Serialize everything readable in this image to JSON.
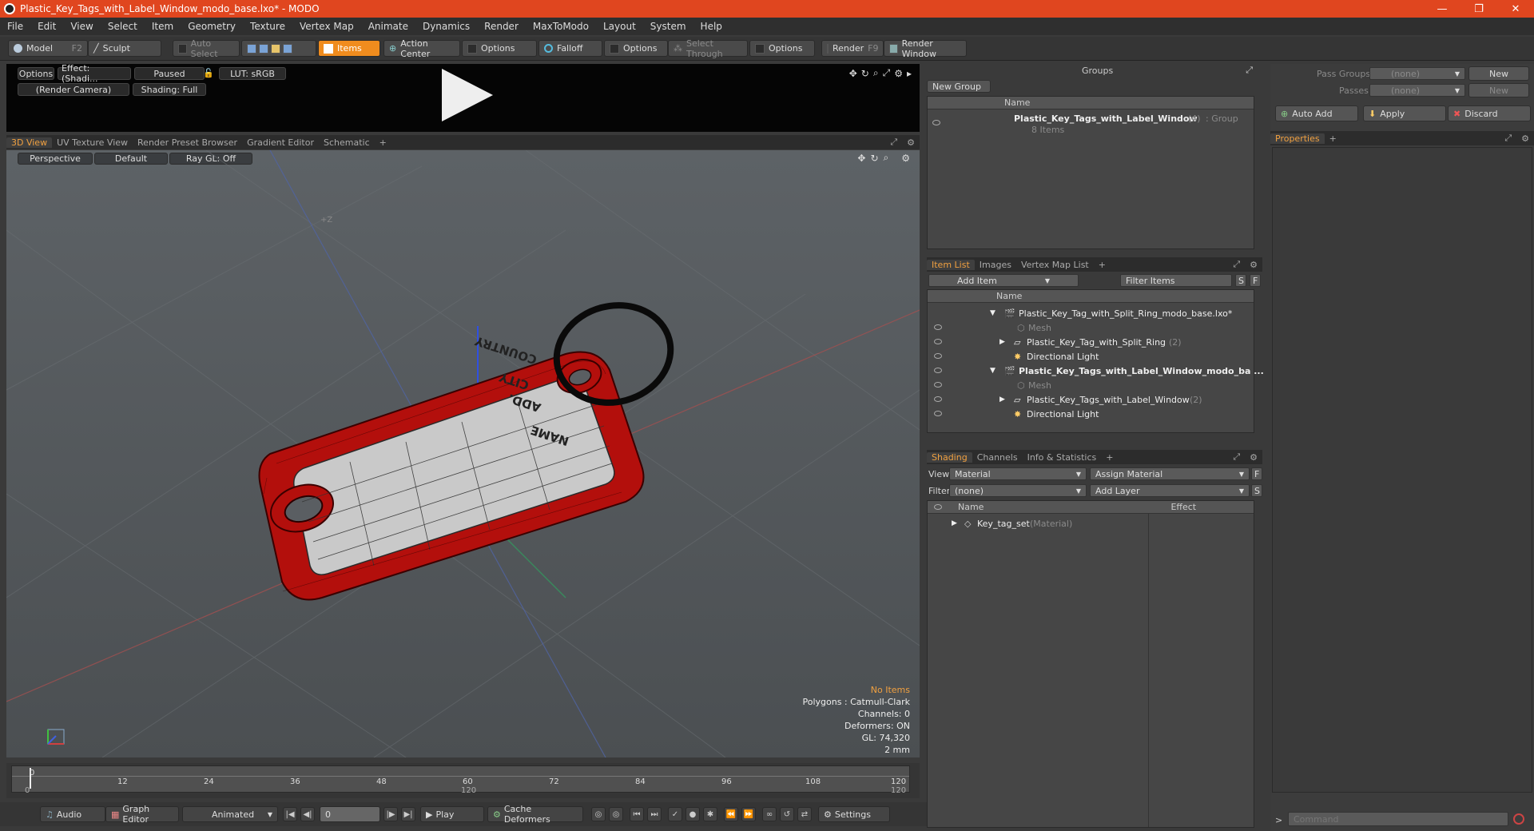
{
  "window": {
    "title": "Plastic_Key_Tags_with_Label_Window_modo_base.lxo* - MODO",
    "controls": [
      "—",
      "❐",
      "✕"
    ]
  },
  "menu": [
    "File",
    "Edit",
    "View",
    "Select",
    "Item",
    "Geometry",
    "Texture",
    "Vertex Map",
    "Animate",
    "Dynamics",
    "Render",
    "MaxToModo",
    "Layout",
    "System",
    "Help"
  ],
  "toolbar": {
    "model": "Model",
    "model_key": "F2",
    "sculpt": "Sculpt",
    "auto_select": "Auto Select",
    "items": "Items",
    "action_center": "Action Center",
    "options1": "Options",
    "falloff": "Falloff",
    "options2": "Options",
    "select_through": "Select Through",
    "options3": "Options",
    "render": "Render",
    "render_key": "F9",
    "render_window": "Render Window"
  },
  "preview": {
    "options": "Options",
    "effect": "Effect: (Shadi...",
    "paused": "Paused",
    "lut": "LUT: sRGB",
    "camera": "(Render Camera)",
    "shading": "Shading: Full"
  },
  "view_tabs": [
    "3D View",
    "UV Texture View",
    "Render Preset Browser",
    "Gradient Editor",
    "Schematic",
    "+"
  ],
  "viewport": {
    "perspective": "Perspective",
    "default": "Default",
    "raygl": "Ray GL: Off",
    "axis_label": "+Z",
    "stats": {
      "no_items": "No Items",
      "polygons": "Polygons : Catmull-Clark",
      "channels": "Channels: 0",
      "deformers": "Deformers: ON",
      "gl": "GL: 74,320",
      "scale": "2 mm"
    },
    "tag_labels": [
      "NAME",
      "ADD.",
      "CITY",
      "COUNTRY"
    ]
  },
  "timeline": {
    "ticks": [
      "0",
      "12",
      "24",
      "36",
      "48",
      "60",
      "72",
      "84",
      "96",
      "108",
      "120"
    ],
    "range_start": "0",
    "range_mid": "120",
    "range_end": "120"
  },
  "bottombar": {
    "audio": "Audio",
    "graph_editor": "Graph Editor",
    "animated": "Animated",
    "frame": "0",
    "play": "Play",
    "cache": "Cache Deformers",
    "settings": "Settings"
  },
  "groups": {
    "title": "Groups",
    "new_group": "New Group",
    "col_name": "Name",
    "item_name": "Plastic_Key_Tags_with_Label_Window",
    "item_count": "(4)",
    "item_type": ": Group",
    "item_sub": "8 Items"
  },
  "pass_groups": {
    "pass_groups_label": "Pass Groups",
    "pass_groups_value": "(none)",
    "new1": "New",
    "passes_label": "Passes",
    "passes_value": "(none)",
    "new2": "New",
    "auto_add": "Auto Add",
    "apply": "Apply",
    "discard": "Discard",
    "properties": "Properties"
  },
  "item_list": {
    "tabs": [
      "Item List",
      "Images",
      "Vertex Map List",
      "+"
    ],
    "add_item": "Add Item",
    "filter_items": "Filter Items",
    "s": "S",
    "f": "F",
    "col_name": "Name",
    "rows": [
      {
        "label": "Plastic_Key_Tag_with_Split_Ring_modo_base.lxo*",
        "count": ""
      },
      {
        "label": "Mesh",
        "count": ""
      },
      {
        "label": "Plastic_Key_Tag_with_Split_Ring",
        "count": "(2)"
      },
      {
        "label": "Directional Light",
        "count": ""
      },
      {
        "label": "Plastic_Key_Tags_with_Label_Window_modo_ba ...",
        "count": ""
      },
      {
        "label": "Mesh",
        "count": ""
      },
      {
        "label": "Plastic_Key_Tags_with_Label_Window",
        "count": "(2)"
      },
      {
        "label": "Directional Light",
        "count": ""
      }
    ]
  },
  "shading": {
    "tabs": [
      "Shading",
      "Channels",
      "Info & Statistics",
      "+"
    ],
    "view_label": "View",
    "view_value": "Material",
    "assign_material": "Assign Material",
    "f": "F",
    "filter_label": "Filter",
    "filter_value": "(none)",
    "add_layer": "Add Layer",
    "s": "S",
    "col_name": "Name",
    "col_effect": "Effect",
    "row_name": "Key_tag_set",
    "row_type": "(Material)"
  },
  "command": {
    "placeholder": "Command",
    "prompt": ">"
  },
  "colors": {
    "title": "#e0461f",
    "accent": "#f08c1e",
    "tag_red": "#c8140f"
  }
}
